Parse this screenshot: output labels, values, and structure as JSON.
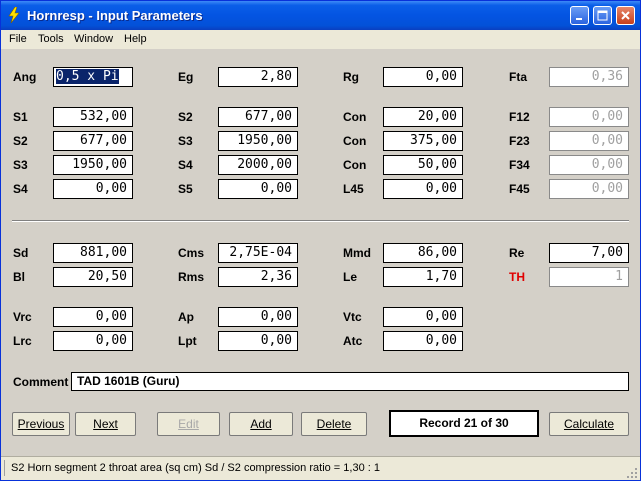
{
  "window": {
    "title": "Hornresp - Input Parameters"
  },
  "menu": [
    "File",
    "Tools",
    "Window",
    "Help"
  ],
  "params": {
    "ang": {
      "label": "Ang",
      "value": "0,5 x Pi"
    },
    "eg": {
      "label": "Eg",
      "value": "2,80"
    },
    "rg": {
      "label": "Rg",
      "value": "0,00"
    },
    "fta": {
      "label": "Fta",
      "value": "0,36"
    },
    "s1": {
      "label": "S1",
      "value": "532,00"
    },
    "s2a": {
      "label": "S2",
      "value": "677,00"
    },
    "con1": {
      "label": "Con",
      "value": "20,00"
    },
    "f12": {
      "label": "F12",
      "value": "0,00"
    },
    "s2b": {
      "label": "S2",
      "value": "677,00"
    },
    "s3a": {
      "label": "S3",
      "value": "1950,00"
    },
    "con2": {
      "label": "Con",
      "value": "375,00"
    },
    "f23": {
      "label": "F23",
      "value": "0,00"
    },
    "s3b": {
      "label": "S3",
      "value": "1950,00"
    },
    "s4a": {
      "label": "S4",
      "value": "2000,00"
    },
    "con3": {
      "label": "Con",
      "value": "50,00"
    },
    "f34": {
      "label": "F34",
      "value": "0,00"
    },
    "s4b": {
      "label": "S4",
      "value": "0,00"
    },
    "s5": {
      "label": "S5",
      "value": "0,00"
    },
    "l45": {
      "label": "L45",
      "value": "0,00"
    },
    "f45": {
      "label": "F45",
      "value": "0,00"
    },
    "sd": {
      "label": "Sd",
      "value": "881,00"
    },
    "cms": {
      "label": "Cms",
      "value": "2,75E-04"
    },
    "mmd": {
      "label": "Mmd",
      "value": "86,00"
    },
    "re": {
      "label": "Re",
      "value": "7,00"
    },
    "bl": {
      "label": "Bl",
      "value": "20,50"
    },
    "rms": {
      "label": "Rms",
      "value": "2,36"
    },
    "le": {
      "label": "Le",
      "value": "1,70"
    },
    "th": {
      "label": "TH",
      "value": "1"
    },
    "vrc": {
      "label": "Vrc",
      "value": "0,00"
    },
    "ap": {
      "label": "Ap",
      "value": "0,00"
    },
    "vtc": {
      "label": "Vtc",
      "value": "0,00"
    },
    "lrc": {
      "label": "Lrc",
      "value": "0,00"
    },
    "lpt": {
      "label": "Lpt",
      "value": "0,00"
    },
    "atc": {
      "label": "Atc",
      "value": "0,00"
    }
  },
  "comment": {
    "label": "Comment",
    "value": "TAD 1601B (Guru)"
  },
  "buttons": {
    "previous": "Previous",
    "next": "Next",
    "edit": "Edit",
    "add": "Add",
    "delete": "Delete",
    "calculate": "Calculate"
  },
  "record": "Record 21 of 30",
  "status": "S2   Horn segment 2 throat area  (sq cm)    Sd / S2 compression ratio = 1,30 : 1",
  "colors": {
    "title_bar": "#0454e2",
    "th_label": "#e00000",
    "client_bg": "#d4d0c8"
  }
}
